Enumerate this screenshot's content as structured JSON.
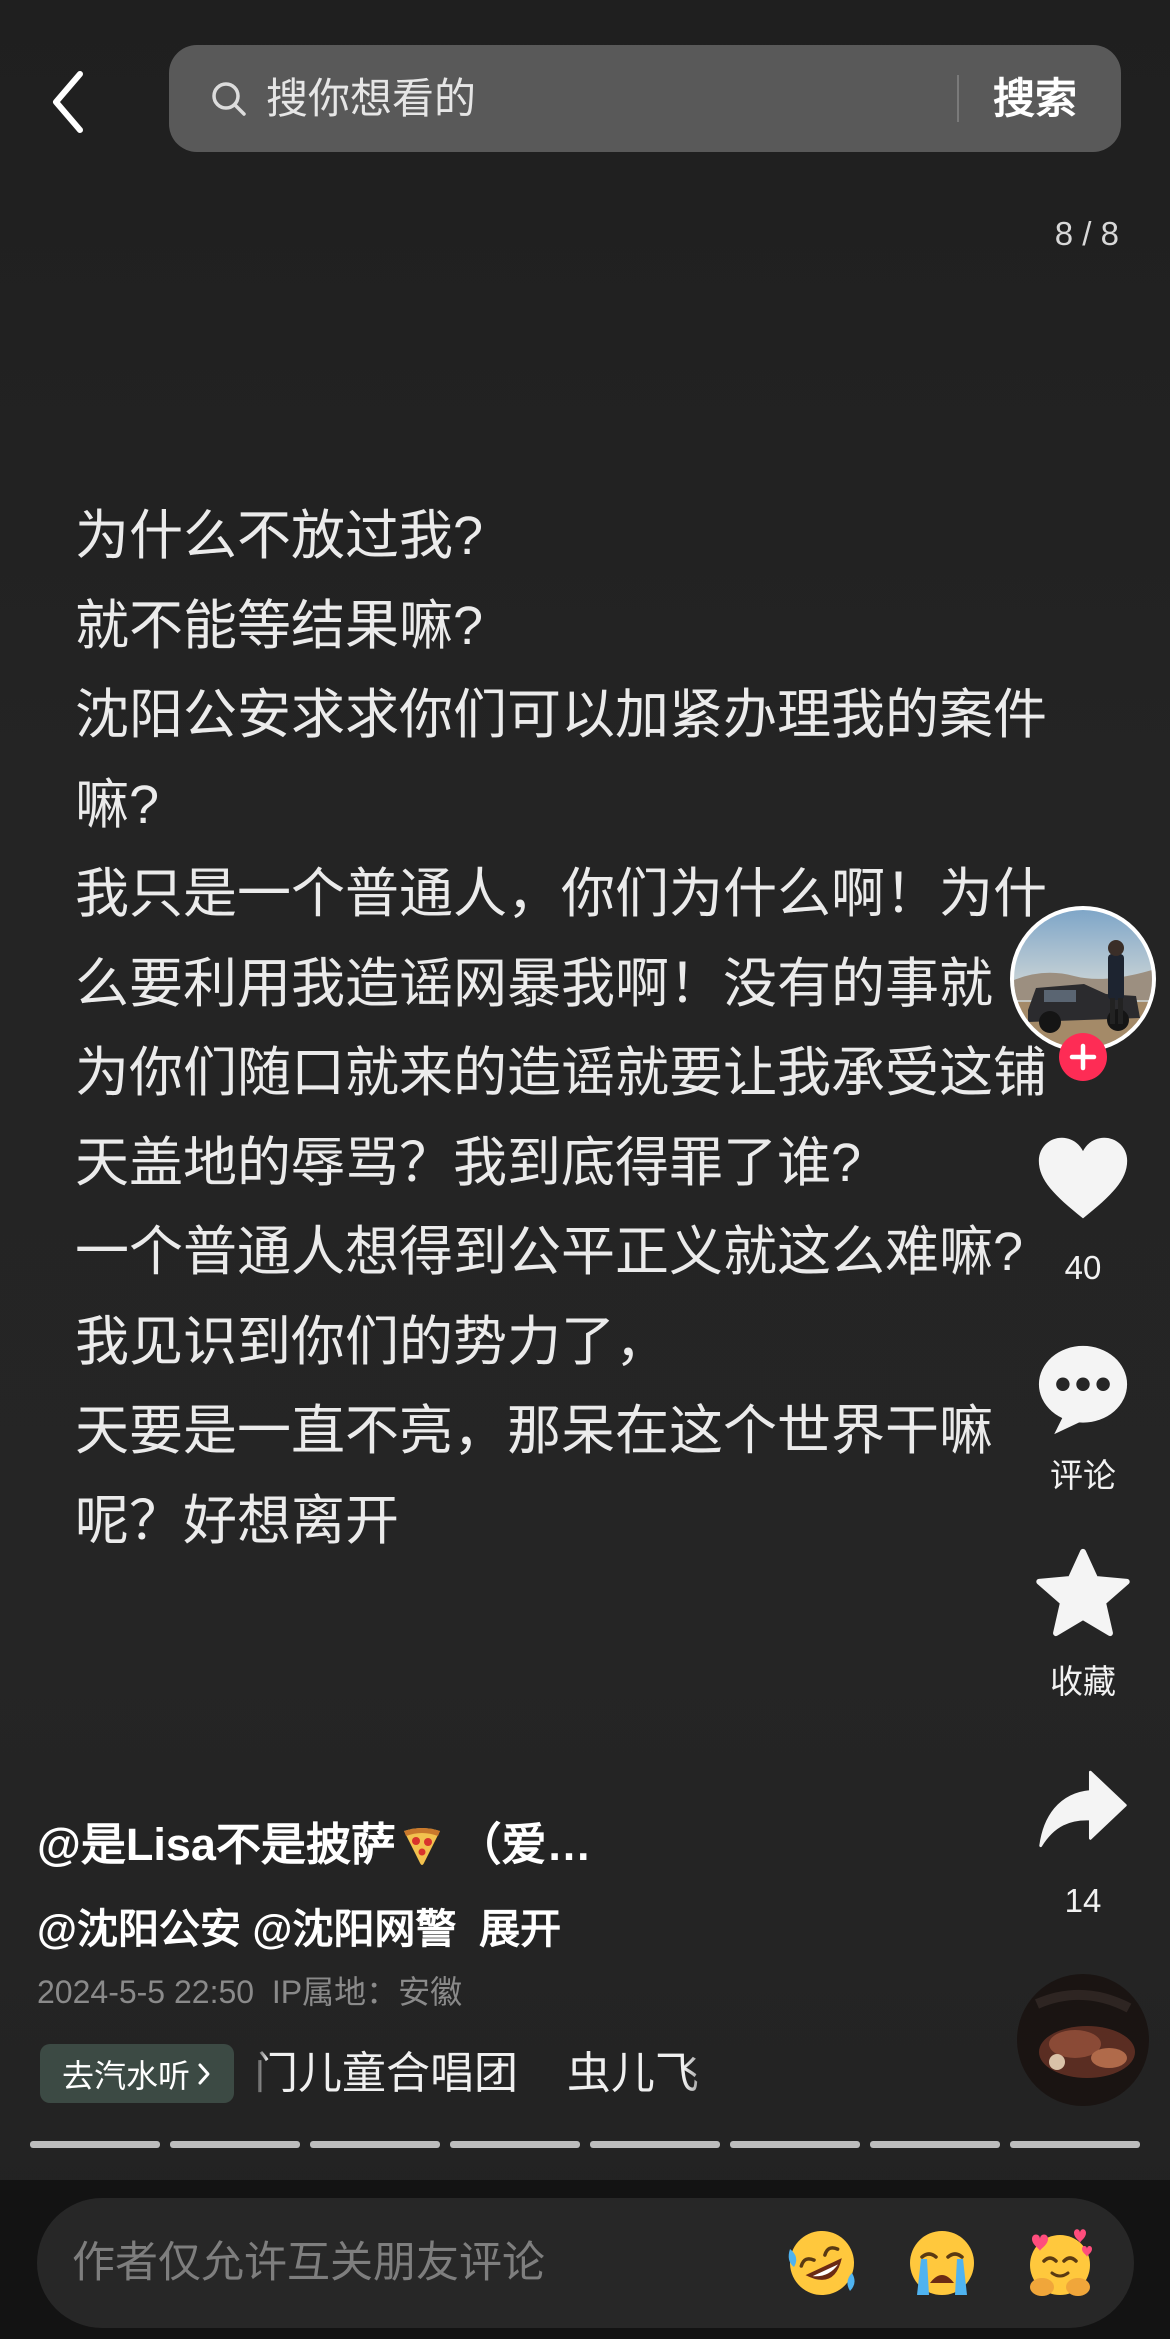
{
  "header": {
    "back_icon": "back-arrow-icon",
    "search_icon": "search-icon",
    "search_placeholder": "搜你想看的",
    "search_button": "搜索"
  },
  "page_indicator": "8 / 8",
  "post": {
    "lines": [
      "为什么不放过我?",
      "就不能等结果嘛?",
      "沈阳公安求求你们可以加紧办理我的案件",
      "嘛?",
      "我只是一个普通人，你们为什么啊！为什",
      "么要利用我造谣网暴我啊！没有的事就",
      "为你们随口就来的造谣就要让我承受这铺",
      "天盖地的辱骂？我到底得罪了谁?",
      "一个普通人想得到公平正义就这么难嘛?",
      "我见识到你们的势力了，",
      "天要是一直不亮，那呆在这个世界干嘛",
      "呢？好想离开"
    ]
  },
  "sidebar": {
    "avatar": "author-avatar",
    "follow_icon": "plus-icon",
    "like_icon": "heart-icon",
    "like_count": "40",
    "comment_icon": "comment-icon",
    "comment_label": "评论",
    "favorite_icon": "star-icon",
    "favorite_label": "收藏",
    "share_icon": "share-icon",
    "share_count": "14",
    "music_disc": "music-disc-avatar"
  },
  "info": {
    "author": "@是Lisa不是披萨",
    "author_emoji": "pizza-icon",
    "author_suffix": " （爱…",
    "mentions": "@沈阳公安 @沈阳网警",
    "expand": "展开",
    "date": "2024-5-5 22:50",
    "ip_location": "IP属地：安徽"
  },
  "music": {
    "button": "去汽水听",
    "chevron_icon": "chevron-right-icon",
    "title": "门儿童合唱团    虫儿飞"
  },
  "progress": {
    "total": 8,
    "current": 8
  },
  "comment_bar": {
    "placeholder": "作者仅允许互关朋友评论",
    "emojis": [
      "rolling-laughing-emoji",
      "crying-emoji",
      "hugging-hearts-emoji"
    ]
  },
  "colors": {
    "background": "#242424",
    "bottom_bar": "#131313",
    "search_bar": "#595959",
    "follow_badge": "#fe2c55",
    "music_pill": "#3c4a44",
    "progress_filled": "#bdbdbd"
  }
}
